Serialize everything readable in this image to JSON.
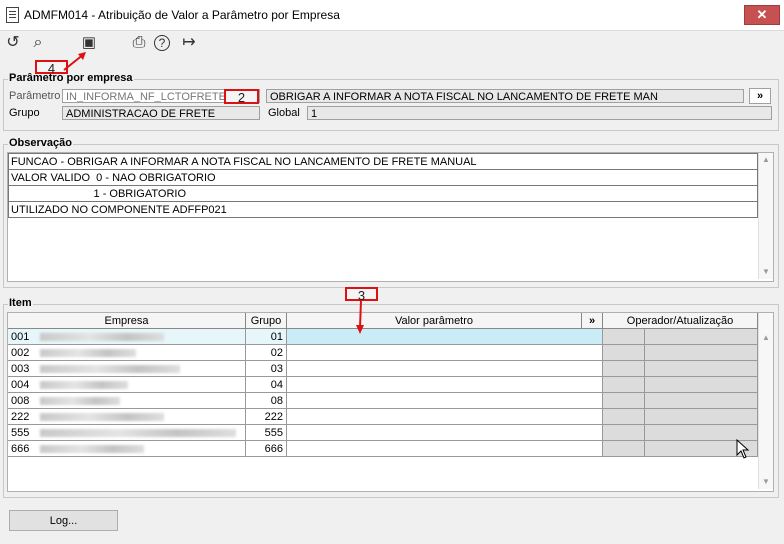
{
  "window": {
    "title": "ADMFM014 - Atribuição de Valor a Parâmetro por Empresa",
    "close_glyph": "✕"
  },
  "toolbar": {
    "refresh_glyph": "↺",
    "search_glyph": "⌕",
    "save_glyph": "▣",
    "print_glyph": "⎙",
    "help_glyph": "?",
    "exit_glyph": "↦"
  },
  "param_section": {
    "legend": "Parâmetro por empresa",
    "parametro_label": "Parâmetro",
    "parametro_value": "IN_INFORMA_NF_LCTOFRETE",
    "descricao_value": "OBRIGAR A INFORMAR A NOTA FISCAL NO LANCAMENTO DE FRETE MAN",
    "expand_label": "»",
    "grupo_label": "Grupo",
    "grupo_value": "ADMINISTRACAO DE FRETE",
    "global_label": "Global",
    "global_value": "1"
  },
  "obs_section": {
    "legend": "Observação",
    "lines": [
      "FUNCAO - OBRIGAR A INFORMAR A NOTA FISCAL NO LANCAMENTO DE FRETE MANUAL",
      "VALOR VALIDO  0 - NAO OBRIGATORIO",
      "                           1 - OBRIGATORIO",
      "UTILIZADO NO COMPONENTE ADFFP021"
    ]
  },
  "item_section": {
    "legend": "Item",
    "columns": {
      "empresa": "Empresa",
      "grupo": "Grupo",
      "valor": "Valor parâmetro",
      "expand": "»",
      "operador": "Operador/Atualização"
    },
    "rows": [
      {
        "codigo": "001",
        "grupo": "01",
        "blur_width": 0.62
      },
      {
        "codigo": "002",
        "grupo": "02",
        "blur_width": 0.48
      },
      {
        "codigo": "003",
        "grupo": "03",
        "blur_width": 0.7
      },
      {
        "codigo": "004",
        "grupo": "04",
        "blur_width": 0.44
      },
      {
        "codigo": "008",
        "grupo": "08",
        "blur_width": 0.4
      },
      {
        "codigo": "222",
        "grupo": "222",
        "blur_width": 0.62
      },
      {
        "codigo": "555",
        "grupo": "555",
        "blur_width": 0.98
      },
      {
        "codigo": "666",
        "grupo": "666",
        "blur_width": 0.52
      }
    ]
  },
  "buttons": {
    "log_label": "Log..."
  },
  "annotations": {
    "a2": "2",
    "a3": "3",
    "a4": "4",
    "color": "#d11111"
  },
  "colors": {
    "selected_row": "#e6f6fb",
    "close_button": "#c75050"
  }
}
